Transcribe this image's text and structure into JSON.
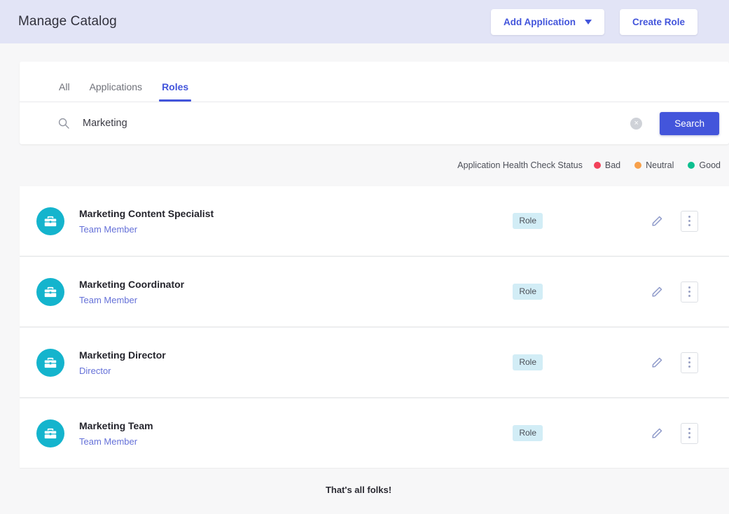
{
  "header": {
    "title": "Manage Catalog",
    "add_application_label": "Add Application",
    "create_role_label": "Create Role"
  },
  "tabs": [
    {
      "label": "All",
      "active": false
    },
    {
      "label": "Applications",
      "active": false
    },
    {
      "label": "Roles",
      "active": true
    }
  ],
  "search": {
    "value": "Marketing",
    "placeholder": "Search",
    "button_label": "Search",
    "clear_glyph": "×"
  },
  "legend": {
    "label": "Application Health Check Status",
    "items": [
      {
        "label": "Bad",
        "color": "#f2415a"
      },
      {
        "label": "Neutral",
        "color": "#f5a košt"
      },
      {
        "label": "Good",
        "color": "#0dbf8f"
      }
    ]
  },
  "legend_items": [
    {
      "label": "Bad",
      "color": "#f2415a"
    },
    {
      "label": "Neutral",
      "color": "#f7a04a"
    },
    {
      "label": "Good",
      "color": "#0dbf8f"
    }
  ],
  "rows": [
    {
      "title": "Marketing Content Specialist",
      "subtitle": "Team Member",
      "badge": "Role"
    },
    {
      "title": "Marketing Coordinator",
      "subtitle": "Team Member",
      "badge": "Role"
    },
    {
      "title": "Marketing Director",
      "subtitle": "Director",
      "badge": "Role"
    },
    {
      "title": "Marketing Team",
      "subtitle": "Team Member",
      "badge": "Role"
    }
  ],
  "footer": {
    "note": "That's all folks!"
  },
  "colors": {
    "accent": "#4355db",
    "header_bg": "#e2e4f6",
    "avatar": "#14b4cd",
    "badge_bg": "#d2edf6"
  }
}
